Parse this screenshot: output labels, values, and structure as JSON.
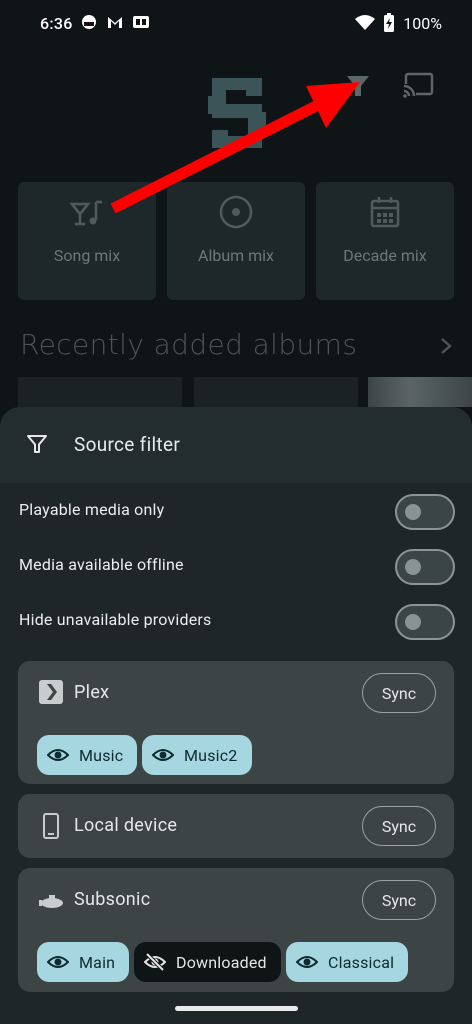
{
  "status": {
    "time": "6:36",
    "battery": "100%"
  },
  "background": {
    "mixes": [
      {
        "label": "Song mix",
        "icon": "cocktail-music-icon"
      },
      {
        "label": "Album mix",
        "icon": "disc-icon"
      },
      {
        "label": "Decade mix",
        "icon": "calendar-icon"
      }
    ],
    "section_title": "Recently added albums"
  },
  "sheet": {
    "title": "Source filter",
    "toggles": [
      {
        "label": "Playable media only",
        "on": false
      },
      {
        "label": "Media available offline",
        "on": false
      },
      {
        "label": "Hide unavailable providers",
        "on": false
      }
    ],
    "providers": [
      {
        "name": "Plex",
        "icon": "plex-icon",
        "sync_label": "Sync",
        "libraries": [
          {
            "label": "Music",
            "visible": true
          },
          {
            "label": "Music2",
            "visible": true
          }
        ]
      },
      {
        "name": "Local device",
        "icon": "phone-icon",
        "sync_label": "Sync",
        "libraries": []
      },
      {
        "name": "Subsonic",
        "icon": "submarine-icon",
        "sync_label": "Sync",
        "libraries": [
          {
            "label": "Main",
            "visible": true
          },
          {
            "label": "Downloaded",
            "visible": false
          },
          {
            "label": "Classical",
            "visible": true
          }
        ]
      }
    ]
  },
  "colors": {
    "chip_active": "#a6d7e0",
    "chip_inactive": "#0f1415",
    "annotation_arrow": "#ff0000"
  }
}
